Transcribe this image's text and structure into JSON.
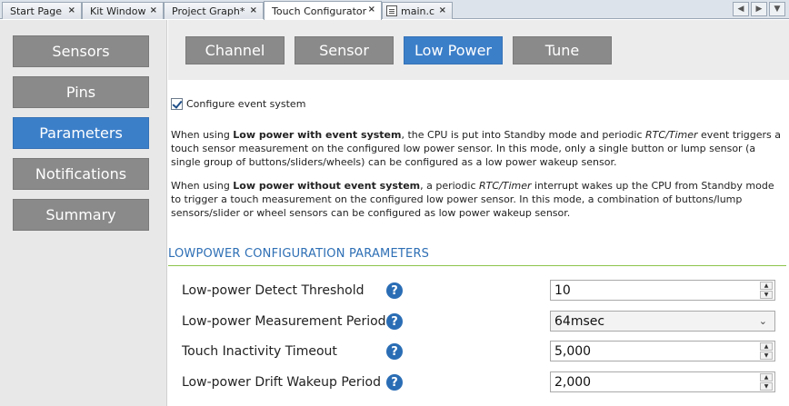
{
  "tabs": [
    {
      "label": "Start Page",
      "closable": true
    },
    {
      "label": "Kit Window",
      "closable": true
    },
    {
      "label": "Project Graph*",
      "closable": true
    },
    {
      "label": "Touch Configurator",
      "closable": true,
      "active": true
    },
    {
      "label": "main.c",
      "closable": true
    }
  ],
  "sidebar": {
    "items": [
      {
        "label": "Sensors"
      },
      {
        "label": "Pins"
      },
      {
        "label": "Parameters",
        "active": true
      },
      {
        "label": "Notifications"
      },
      {
        "label": "Summary"
      }
    ]
  },
  "topnav": {
    "items": [
      {
        "label": "Channel"
      },
      {
        "label": "Sensor"
      },
      {
        "label": "Low Power",
        "active": true
      },
      {
        "label": "Tune"
      }
    ]
  },
  "event_system": {
    "checked": true,
    "label": "Configure event system"
  },
  "descriptions": {
    "with_event": {
      "p1": "When using ",
      "b1": "Low power with event system",
      "p2": ", the CPU is put into Standby mode and periodic ",
      "i1": "RTC/Timer",
      "p3": " event triggers a touch sensor measurement on the configured low power sensor. In this mode, only a single button or lump sensor (a single group of buttons/sliders/wheels) can be configured as a low power wakeup sensor."
    },
    "without_event": {
      "p1": "When using ",
      "b1": "Low power without event system",
      "p2": ", a periodic ",
      "i1": "RTC/Timer",
      "p3": " interrupt wakes up the CPU from Standby mode to trigger a touch measurement on the configured low power sensor. In this mode, a combination of buttons/lump sensors/slider or wheel sensors can be configured as low power wakeup sensor."
    }
  },
  "section": {
    "title": "LOWPOWER CONFIGURATION PARAMETERS"
  },
  "params": [
    {
      "label": "Low-power Detect Threshold",
      "value": "10",
      "control": "spinner"
    },
    {
      "label": "Low-power Measurement Period",
      "value": "64msec",
      "control": "dropdown"
    },
    {
      "label": "Touch Inactivity Timeout",
      "value": "5,000",
      "control": "spinner"
    },
    {
      "label": "Low-power Drift Wakeup Period",
      "value": "2,000",
      "control": "spinner"
    }
  ],
  "icons": {
    "close": "close-icon",
    "help": "help-icon",
    "file": "file-icon",
    "spin_up": "spin-up-icon",
    "spin_down": "spin-down-icon",
    "dropdown": "chevron-down-icon",
    "check": "checkmark-icon"
  },
  "colors": {
    "accent": "#3c7fc9",
    "button_gray": "#8a8a8a",
    "section_title": "#2e6fb5",
    "section_line": "#8cc34a",
    "help_icon": "#2a6db5"
  }
}
